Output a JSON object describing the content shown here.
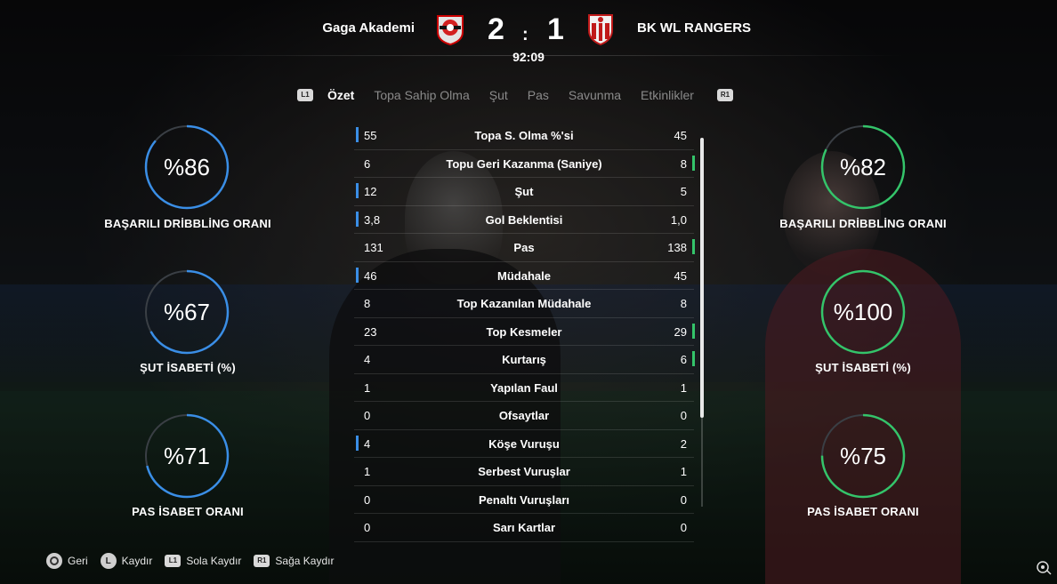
{
  "match": {
    "home_team": "Gaga Akademi",
    "away_team": "BK WL RANGERS",
    "home_score": "2",
    "separator": ":",
    "away_score": "1",
    "time": "92:09"
  },
  "tabs": {
    "left_button": "L1",
    "right_button": "R1",
    "items": [
      "Özet",
      "Topa Sahip Olma",
      "Şut",
      "Pas",
      "Savunma",
      "Etkinlikler"
    ],
    "active": "Özet"
  },
  "home_stats": [
    {
      "value": "%86",
      "label": "BAŞARILI DRİBBLİNG ORANI",
      "fraction": 0.86
    },
    {
      "value": "%67",
      "label": "ŞUT İSABETİ (%)",
      "fraction": 0.67
    },
    {
      "value": "%71",
      "label": "PAS İSABET ORANI",
      "fraction": 0.71
    }
  ],
  "away_stats": [
    {
      "value": "%82",
      "label": "BAŞARILI DRİBBLİNG ORANI",
      "fraction": 0.82
    },
    {
      "value": "%100",
      "label": "ŞUT İSABETİ (%)",
      "fraction": 1.0
    },
    {
      "value": "%75",
      "label": "PAS İSABET ORANI",
      "fraction": 0.75
    }
  ],
  "table": {
    "rows": [
      {
        "home": "55",
        "name": "Topa S. Olma %'si",
        "away": "45",
        "leader": "home"
      },
      {
        "home": "6",
        "name": "Topu Geri Kazanma (Saniye)",
        "away": "8",
        "leader": "away"
      },
      {
        "home": "12",
        "name": "Şut",
        "away": "5",
        "leader": "home"
      },
      {
        "home": "3,8",
        "name": "Gol Beklentisi",
        "away": "1,0",
        "leader": "home"
      },
      {
        "home": "131",
        "name": "Pas",
        "away": "138",
        "leader": "away"
      },
      {
        "home": "46",
        "name": "Müdahale",
        "away": "45",
        "leader": "home"
      },
      {
        "home": "8",
        "name": "Top Kazanılan Müdahale",
        "away": "8",
        "leader": "none"
      },
      {
        "home": "23",
        "name": "Top Kesmeler",
        "away": "29",
        "leader": "away"
      },
      {
        "home": "4",
        "name": "Kurtarış",
        "away": "6",
        "leader": "away"
      },
      {
        "home": "1",
        "name": "Yapılan Faul",
        "away": "1",
        "leader": "none"
      },
      {
        "home": "0",
        "name": "Ofsaytlar",
        "away": "0",
        "leader": "none"
      },
      {
        "home": "4",
        "name": "Köşe Vuruşu",
        "away": "2",
        "leader": "home"
      },
      {
        "home": "1",
        "name": "Serbest Vuruşlar",
        "away": "1",
        "leader": "none"
      },
      {
        "home": "0",
        "name": "Penaltı Vuruşları",
        "away": "0",
        "leader": "none"
      },
      {
        "home": "0",
        "name": "Sarı Kartlar",
        "away": "0",
        "leader": "none"
      }
    ]
  },
  "footer": {
    "back": "Geri",
    "scroll_button": "L",
    "scroll": "Kaydır",
    "left_button": "L1",
    "scroll_left": "Sola Kaydır",
    "right_button": "R1",
    "scroll_right": "Sağa Kaydır"
  },
  "colors": {
    "home_accent": "#3a8ee6",
    "away_accent": "#34c46a",
    "ring_track": "#3a3f45"
  }
}
